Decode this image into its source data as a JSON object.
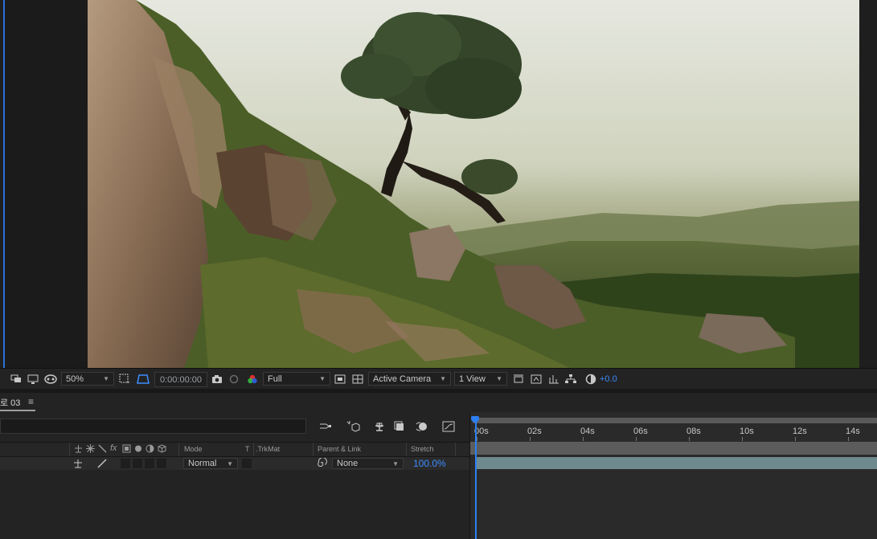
{
  "viewer_toolbar": {
    "magnification": "50%",
    "timecode": "0:00:00:00",
    "resolution": "Full",
    "camera": "Active Camera",
    "views": "1 View",
    "exposure": "+0.0"
  },
  "panel": {
    "tab_label": "로 03",
    "menu_glyph": "≡"
  },
  "columns": {
    "mode": "Mode",
    "t": "T",
    "trkmat": ".TrkMat",
    "parent": "Parent & Link",
    "stretch": "Stretch"
  },
  "layer": {
    "mode": "Normal",
    "parent": "None",
    "stretch": "100.0%"
  },
  "ruler": {
    "labels": [
      "00s",
      "02s",
      "04s",
      "06s",
      "08s",
      "10s",
      "12s",
      "14s"
    ],
    "current_time_seconds": 0
  },
  "icons": {
    "snapshot": "camera-icon",
    "channels": "rgb-channels-icon",
    "fast_previews": "fast-previews-icon",
    "flowchart": "flowchart-icon",
    "reset_exposure": "exposure-icon"
  }
}
